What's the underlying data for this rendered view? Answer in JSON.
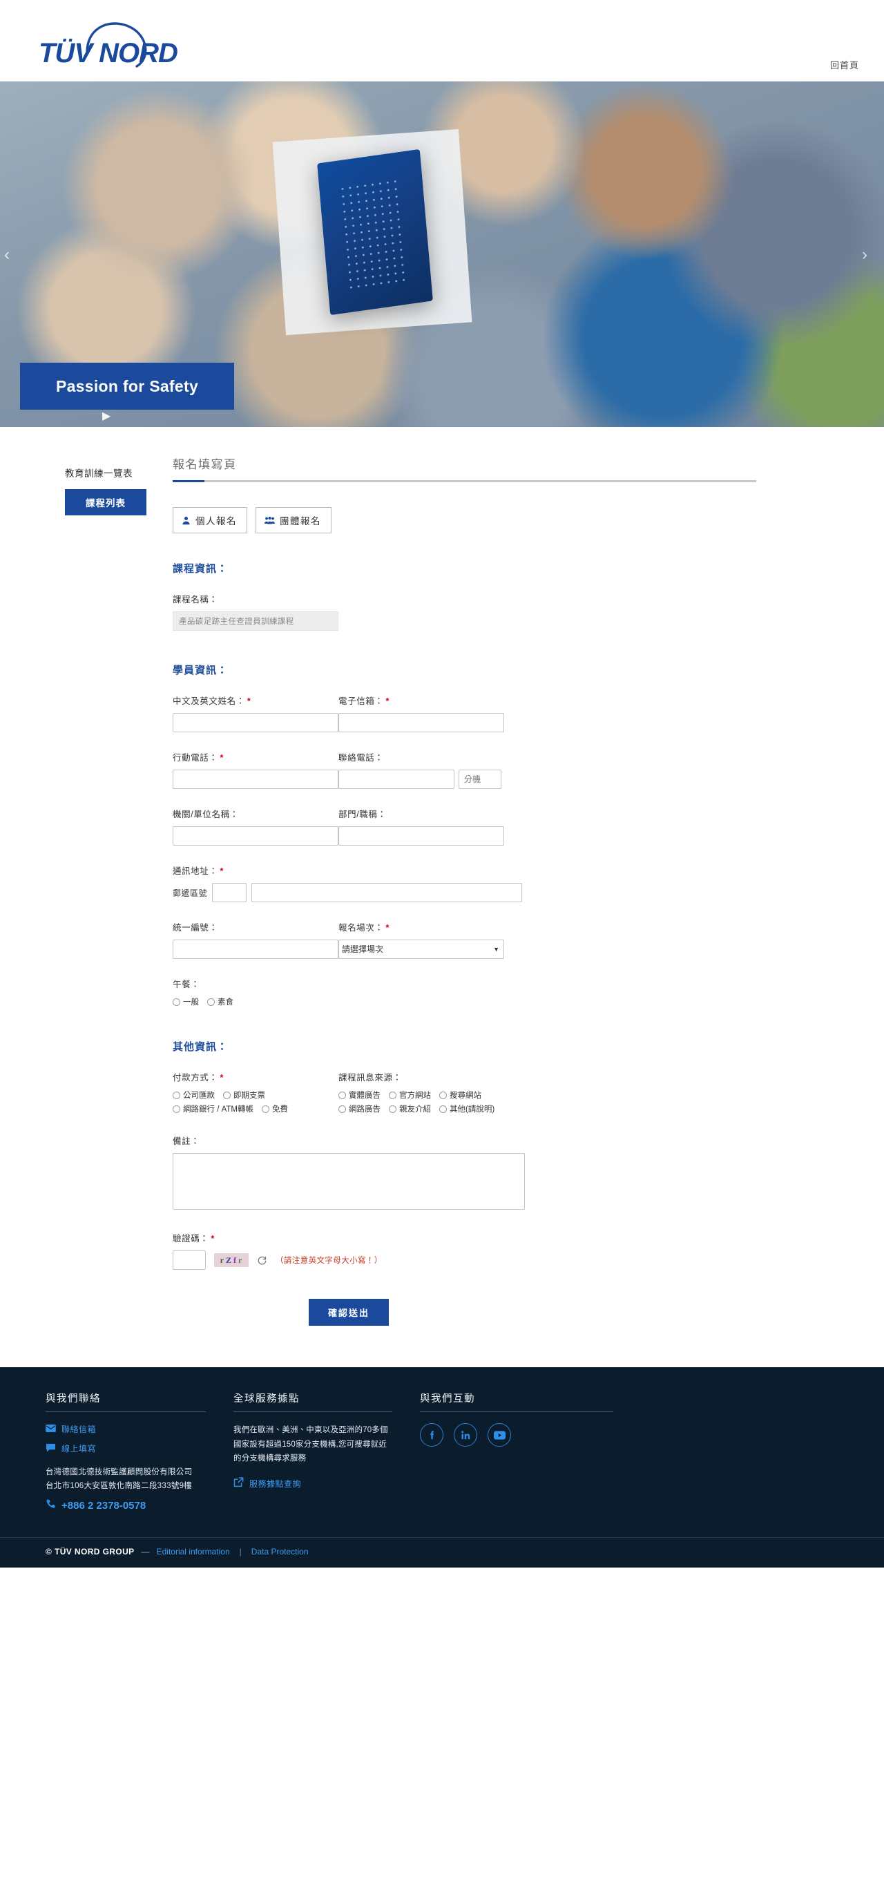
{
  "header": {
    "logo_text": "TÜV NORD",
    "nav": {
      "home_label": "回首頁"
    }
  },
  "hero": {
    "banner_text": "Passion for Safety",
    "arrow_left": "‹",
    "arrow_right": "›",
    "play": "▶"
  },
  "sidebar": {
    "title": "教育訓練一覽表",
    "course_list_label": "課程列表"
  },
  "main": {
    "page_title": "報名填寫頁",
    "tabs": [
      {
        "label": "個人報名",
        "icon": "person-icon",
        "active": true
      },
      {
        "label": "團體報名",
        "icon": "group-icon",
        "active": false
      }
    ],
    "course_section": {
      "heading": "課程資訊：",
      "course_name_label": "課程名稱：",
      "course_name_value": "產品碳足跡主任查證員訓練課程"
    },
    "student_section": {
      "heading": "學員資訊：",
      "fields": {
        "name_label": "中文及英文姓名：",
        "name_value": "",
        "email_label": "電子信箱：",
        "email_value": "",
        "mobile_label": "行動電話：",
        "mobile_value": "",
        "phone_label": "聯絡電話：",
        "phone_value": "",
        "ext_placeholder": "分機",
        "ext_value": "",
        "org_label": "機關/單位名稱：",
        "org_value": "",
        "dept_label": "部門/職稱：",
        "dept_value": "",
        "address_label": "通訊地址：",
        "zip_label": "郵遞區號",
        "zip_value": "",
        "address_value": "",
        "taxid_label": "統一編號：",
        "taxid_value": "",
        "session_label": "報名場次：",
        "session_selected": "請選擇場次",
        "lunch_label": "午餐：",
        "lunch_options": [
          "一般",
          "素食"
        ]
      }
    },
    "other_section": {
      "heading": "其他資訊：",
      "payment_label": "付款方式：",
      "payment_options": [
        "公司匯款",
        "即期支票",
        "網路銀行 / ATM轉帳",
        "免費"
      ],
      "source_label": "課程訊息來源：",
      "source_options": [
        "實體廣告",
        "官方網站",
        "搜尋網站",
        "網路廣告",
        "親友介紹",
        "其他(請說明)"
      ],
      "remark_label": "備註：",
      "remark_value": "",
      "captcha_label": "驗證碼：",
      "captcha_value": "",
      "captcha_image_text": "rZfr",
      "captcha_chars": [
        {
          "ch": "r",
          "color": "#2e6b3c"
        },
        {
          "ch": "Z",
          "color": "#2a3d8f"
        },
        {
          "ch": "f",
          "color": "#8a2bc4"
        },
        {
          "ch": "r",
          "color": "#5f7b52"
        }
      ],
      "refresh_icon": "refresh-icon",
      "captcha_note": "（請注意英文字母大小寫！）",
      "submit_label": "確認送出"
    }
  },
  "footer": {
    "contact": {
      "heading": "與我們聯絡",
      "mail_label": "聯絡信箱",
      "online_label": "線上填寫",
      "company": "台灣德國北德技術監護顧問股份有限公司",
      "address": "台北市106大安區敦化南路二段333號9樓",
      "phone": "+886 2 2378-0578"
    },
    "global": {
      "heading": "全球服務據點",
      "description": "我們在歐洲、美洲、中東以及亞洲的70多個國家設有超過150家分支機構,您可搜尋就近的分支機構尋求服務",
      "link_label": "服務據點查詢"
    },
    "social": {
      "heading": "與我們互動",
      "items": [
        {
          "name": "facebook-icon",
          "glyph": "f"
        },
        {
          "name": "linkedin-icon",
          "glyph": "in"
        },
        {
          "name": "youtube-icon",
          "glyph": "▶"
        }
      ]
    },
    "bottom": {
      "copyright": "© TÜV NORD GROUP",
      "dash": "—",
      "editorial": "Editorial information",
      "pipe": "|",
      "privacy": "Data Protection"
    }
  },
  "colors": {
    "brand_blue": "#1b4a9c",
    "link_blue": "#3f9bf0",
    "required_red": "#d0021b",
    "footer_bg": "#0b1c2c"
  }
}
